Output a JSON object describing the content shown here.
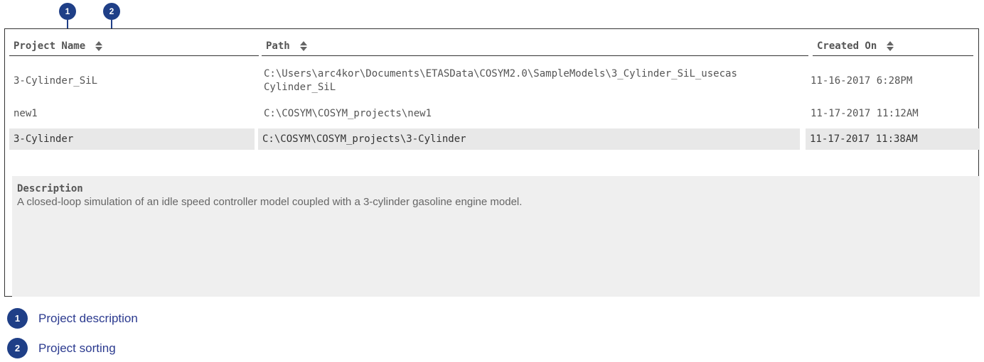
{
  "callouts": {
    "c1": "1",
    "c2": "2"
  },
  "table": {
    "headers": {
      "name": "Project Name",
      "path": "Path",
      "created": "Created On"
    },
    "rows": [
      {
        "name": "3-Cylinder_SiL",
        "path_line1": "C:\\Users\\arc4kor\\Documents\\ETASData\\COSYM2.0\\SampleModels\\3_Cylinder_SiL_usecas",
        "path_line2": "Cylinder_SiL",
        "created": "11-16-2017 6:28PM"
      },
      {
        "name": "new1",
        "path": "C:\\COSYM\\COSYM_projects\\new1",
        "created": "11-17-2017 11:12AM"
      },
      {
        "name": "3-Cylinder",
        "path": "C:\\COSYM\\COSYM_projects\\3-Cylinder",
        "created": "11-17-2017 11:38AM",
        "selected": true
      }
    ]
  },
  "description": {
    "title": "Description",
    "text": "A closed-loop simulation of an idle speed controller model coupled with a 3-cylinder gasoline engine model."
  },
  "legend": [
    {
      "number": "1",
      "label": "Project description"
    },
    {
      "number": "2",
      "label": "Project sorting"
    }
  ],
  "colors": {
    "callout": "#1f3f87",
    "legend_text": "#2b3a8f",
    "selected_row": "#e8e8e8",
    "description_bg": "#efefef"
  }
}
